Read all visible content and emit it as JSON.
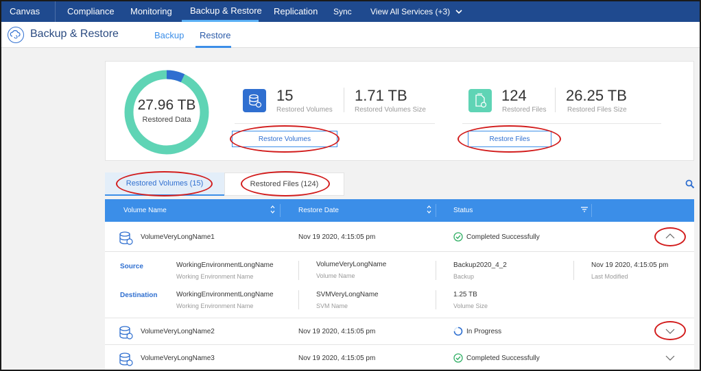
{
  "nav": {
    "items": [
      {
        "label": "Canvas"
      },
      {
        "label": "Compliance"
      },
      {
        "label": "Monitoring"
      },
      {
        "label": "Backup & Restore"
      },
      {
        "label": "Replication"
      },
      {
        "label": "Sync"
      },
      {
        "label": "View All Services (+3)"
      }
    ],
    "active": "Backup & Restore"
  },
  "header": {
    "title": "Backup & Restore",
    "tabs": [
      {
        "label": "Backup"
      },
      {
        "label": "Restore"
      }
    ],
    "active_tab": "Restore"
  },
  "summary": {
    "restored_data_value": "27.96 TB",
    "restored_data_label": "Restored Data",
    "volumes_fraction": 0.07,
    "volumes": {
      "count": "15",
      "count_label": "Restored Volumes",
      "size": "1.71 TB",
      "size_label": "Restored Volumes Size",
      "button": "Restore Volumes"
    },
    "files": {
      "count": "124",
      "count_label": "Restored Files",
      "size": "26.25 TB",
      "size_label": "Restored Files Size",
      "button": "Restore Files"
    }
  },
  "tabs": {
    "volumes": "Restored Volumes (15)",
    "files": "Restored Files (124)"
  },
  "table": {
    "columns": [
      "Volume Name",
      "Restore Date",
      "Status"
    ],
    "rows": [
      {
        "name": "VolumeVeryLongName1",
        "date": "Nov 19 2020, 4:15:05 pm",
        "status": "Completed Successfully"
      },
      {
        "name": "VolumeVeryLongName2",
        "date": "Nov 19 2020, 4:15:05 pm",
        "status": "In Progress"
      },
      {
        "name": "VolumeVeryLongName3",
        "date": "Nov 19 2020, 4:15:05 pm",
        "status": "Completed Successfully"
      }
    ]
  },
  "detail": {
    "source_label": "Source",
    "destination_label": "Destination",
    "source": {
      "env": "WorkingEnvironmentLongName",
      "env_label": "Working Environment Name",
      "volume": "VolumeVeryLongName",
      "volume_label": "Volume Name",
      "backup": "Backup2020_4_2",
      "backup_label": "Backup",
      "modified": "Nov 19 2020, 4:15:05 pm",
      "modified_label": "Last Modified"
    },
    "destination": {
      "env": "WorkingEnvironmentLongName",
      "env_label": "Working Environment Name",
      "svm": "SVMVeryLongName",
      "svm_label": "SVM Name",
      "size": "1.25 TB",
      "size_label": "Volume Size"
    }
  },
  "colors": {
    "nav_bg": "#1f4a8f",
    "accent": "#3b8ee8",
    "donut_files": "#5fd4b5",
    "donut_volumes": "#2f6fd0",
    "success": "#2fae63",
    "annotation": "#d21c1c"
  }
}
